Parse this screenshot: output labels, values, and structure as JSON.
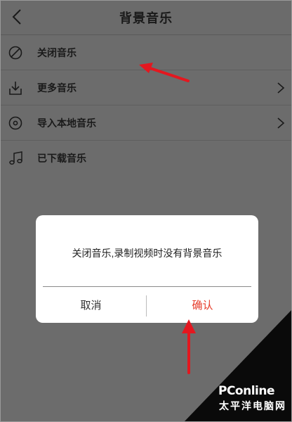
{
  "header": {
    "title": "背景音乐",
    "back_icon": "chevron-left-icon"
  },
  "list": {
    "items": [
      {
        "label": "关闭音乐",
        "icon": "no-music-icon",
        "has_chevron": false
      },
      {
        "label": "更多音乐",
        "icon": "download-icon",
        "has_chevron": true
      },
      {
        "label": "导入本地音乐",
        "icon": "disc-icon",
        "has_chevron": true
      },
      {
        "label": "已下载音乐",
        "icon": "music-note-icon",
        "has_chevron": false
      }
    ]
  },
  "dialog": {
    "message": "关闭音乐,录制视频时没有背景音乐",
    "cancel_label": "取消",
    "confirm_label": "确认"
  },
  "watermark": {
    "brand": "PConline",
    "subtitle": "太平洋电脑网"
  },
  "colors": {
    "overlay": "#6c6c6c",
    "confirm": "#e63a28",
    "arrow": "#e4171f"
  }
}
